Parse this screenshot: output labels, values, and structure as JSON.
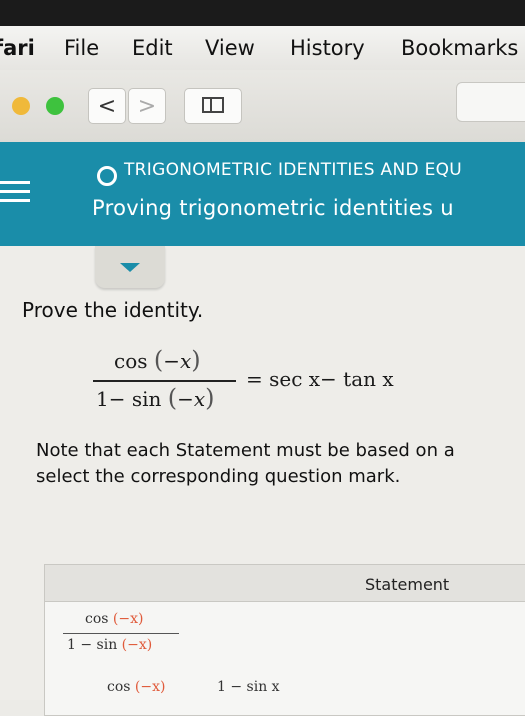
{
  "menu": {
    "app": "fari",
    "items": [
      "File",
      "Edit",
      "View",
      "History",
      "Bookmarks"
    ]
  },
  "toolbar": {
    "back": "<",
    "forward": ">"
  },
  "header": {
    "kicker": "TRIGONOMETRIC IDENTITIES AND EQU",
    "title": "Proving trigonometric identities u"
  },
  "problem": {
    "prompt": "Prove the identity.",
    "numerator": {
      "fn": "cos",
      "open": "(",
      "arg": "−x",
      "close": ")"
    },
    "denominator": {
      "lead": "1− sin",
      "open": "(",
      "arg": "−x",
      "close": ")"
    },
    "rhs": "= sec x− tan x",
    "note_line1": "Note that each Statement must be based on a",
    "note_line2": "select the corresponding question mark."
  },
  "table": {
    "header": "Statement",
    "row1": {
      "num": "cos",
      "num_arg": "(−x)",
      "den": "1 − sin",
      "den_arg": "(−x)"
    },
    "row2": {
      "left": "cos",
      "left_arg": "(−x)",
      "right": "1 − sin x"
    }
  },
  "colors": {
    "header_bg": "#1a8da9",
    "traffic_yellow": "#f0b93a",
    "traffic_green": "#3ec23e"
  }
}
